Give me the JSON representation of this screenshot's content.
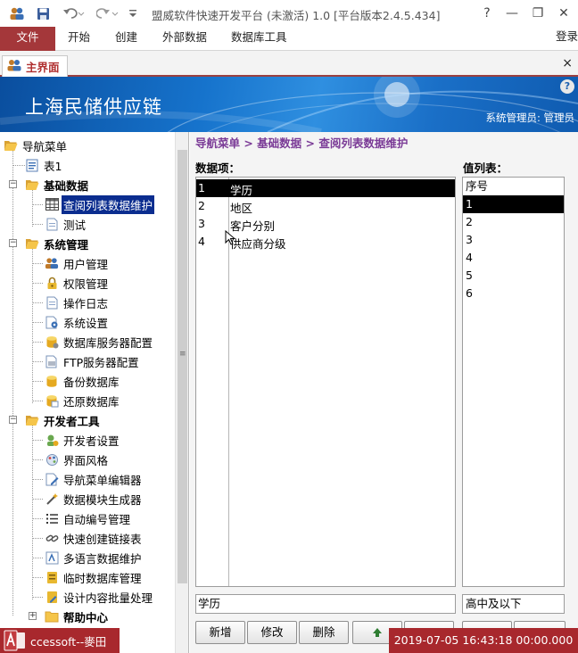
{
  "window": {
    "title": "盟威软件快速开发平台 (未激活) 1.0  [平台版本2.4.5.434]",
    "help_glyph": "?",
    "minimize_glyph": "—",
    "restore_glyph": "❐",
    "close_glyph": "✕"
  },
  "ribbon": {
    "tabs": [
      "文件",
      "开始",
      "创建",
      "外部数据",
      "数据库工具"
    ],
    "login": "登录"
  },
  "doc_tab": {
    "label": "主界面",
    "close_glyph": "×"
  },
  "banner": {
    "title": "上海民储供应链",
    "user": "系统管理员: 管理员",
    "help_glyph": "?"
  },
  "nav": {
    "items": [
      {
        "label": "导航菜单",
        "icon": "folder-open-icon"
      },
      {
        "label": "表1",
        "icon": "form-icon"
      },
      {
        "label": "基础数据",
        "icon": "folder-open-icon"
      },
      {
        "label": "查阅列表数据维护",
        "icon": "table-icon"
      },
      {
        "label": "测试",
        "icon": "document-icon"
      },
      {
        "label": "系统管理",
        "icon": "folder-open-icon"
      },
      {
        "label": "用户管理",
        "icon": "users-icon"
      },
      {
        "label": "权限管理",
        "icon": "lock-icon"
      },
      {
        "label": "操作日志",
        "icon": "document-icon"
      },
      {
        "label": "系统设置",
        "icon": "settings-doc-icon"
      },
      {
        "label": "数据库服务器配置",
        "icon": "database-config-icon"
      },
      {
        "label": "FTP服务器配置",
        "icon": "ftp-icon"
      },
      {
        "label": "备份数据库",
        "icon": "backup-icon"
      },
      {
        "label": "还原数据库",
        "icon": "restore-icon"
      },
      {
        "label": "开发者工具",
        "icon": "folder-open-icon"
      },
      {
        "label": "开发者设置",
        "icon": "developer-icon"
      },
      {
        "label": "界面风格",
        "icon": "palette-icon"
      },
      {
        "label": "导航菜单编辑器",
        "icon": "edit-doc-icon"
      },
      {
        "label": "数据模块生成器",
        "icon": "wand-icon"
      },
      {
        "label": "自动编号管理",
        "icon": "numbered-list-icon"
      },
      {
        "label": "快速创建链接表",
        "icon": "link-icon"
      },
      {
        "label": "多语言数据维护",
        "icon": "language-icon"
      },
      {
        "label": "临时数据库管理",
        "icon": "temp-db-icon"
      },
      {
        "label": "设计内容批量处理",
        "icon": "batch-icon"
      },
      {
        "label": "帮助中心",
        "icon": "folder-icon"
      }
    ],
    "expander_minus": "−",
    "expander_plus": "+",
    "scroll_grip": "≡"
  },
  "content": {
    "breadcrumb": "导航菜单 > 基础数据 > 查阅列表数据维护",
    "items_label": "数据项：",
    "values_label": "值列表：",
    "items": [
      {
        "no": "1",
        "name": "学历"
      },
      {
        "no": "2",
        "name": "地区"
      },
      {
        "no": "3",
        "name": "客户分别"
      },
      {
        "no": "4",
        "name": "供应商分级"
      }
    ],
    "values": [
      "序号",
      "1",
      "2",
      "3",
      "4",
      "5",
      "6"
    ],
    "current_item": "学历",
    "current_value": "高中及以下",
    "buttons": {
      "add": "新增",
      "edit": "修改",
      "delete": "删除"
    }
  },
  "status": {
    "app": "ccessoft--麥田",
    "datetime": "2019-07-05 16:43:18 00:00.000"
  },
  "colors": {
    "accent": "#a4373a",
    "selection": "#0b2d8f",
    "breadcrumb": "#7a3a96",
    "banner": "#1673cc"
  }
}
